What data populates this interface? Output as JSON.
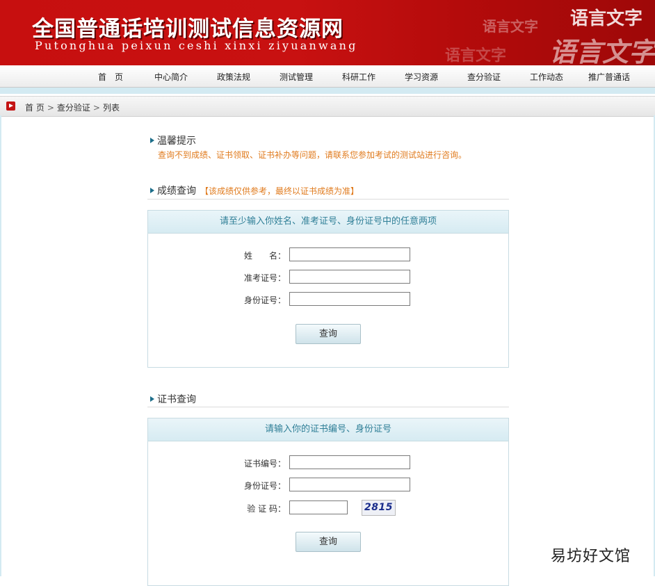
{
  "header": {
    "title": "全国普通话培训测试信息资源网",
    "subtitle": "Putonghua peixun ceshi xinxi ziyuanwang",
    "decor": [
      "语言文字",
      "语言文字",
      "语言文字",
      "语言文字"
    ]
  },
  "nav": {
    "items": [
      {
        "label": "首　页"
      },
      {
        "label": "中心简介"
      },
      {
        "label": "政策法规"
      },
      {
        "label": "测试管理"
      },
      {
        "label": "科研工作"
      },
      {
        "label": "学习资源"
      },
      {
        "label": "查分验证"
      },
      {
        "label": "工作动态"
      },
      {
        "label": "推广普通话"
      }
    ]
  },
  "breadcrumb": {
    "items": [
      "首 页",
      "查分验证",
      "列表"
    ],
    "separator": ">"
  },
  "tip": {
    "title": "温馨提示",
    "text": "查询不到成绩、证书领取、证书补办等问题，请联系您参加考试的测试站进行咨询。"
  },
  "score_query": {
    "title": "成绩查询",
    "note": "【该成绩仅供参考，最终以证书成绩为准】",
    "panel_title": "请至少输入你姓名、准考证号、身份证号中的任意两项",
    "fields": [
      {
        "label": "姓　　名：",
        "value": ""
      },
      {
        "label": "准考证号：",
        "value": ""
      },
      {
        "label": "身份证号：",
        "value": ""
      }
    ],
    "button": "查询"
  },
  "cert_query": {
    "title": "证书查询",
    "panel_title": "请输入你的证书编号、身份证号",
    "fields": [
      {
        "label": "证书编号：",
        "value": ""
      },
      {
        "label": "身份证号：",
        "value": ""
      },
      {
        "label": "验 证 码：",
        "value": ""
      }
    ],
    "captcha": "2815",
    "button": "查询"
  },
  "watermark": "易坊好文馆",
  "colors": {
    "banner_red": "#c70f0f",
    "accent_blue": "#2f7f97",
    "note_orange": "#e07b1e",
    "captcha_text": "#1a2d8c"
  }
}
